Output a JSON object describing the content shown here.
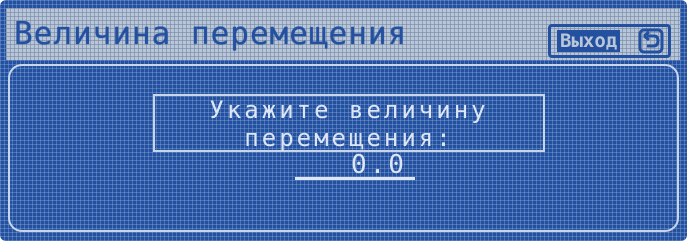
{
  "titlebar": {
    "title": "Величина перемещения",
    "exit_label": "Выход",
    "exit_icon": "return-arrow-icon"
  },
  "prompt": {
    "line1": "Укажите величину",
    "line2": "перемещения:"
  },
  "input": {
    "value": "0.0"
  },
  "colors": {
    "screen_blue": "#2450a0",
    "titlebar_grey": "#b8c6d8",
    "text_light": "#dde6f4"
  }
}
